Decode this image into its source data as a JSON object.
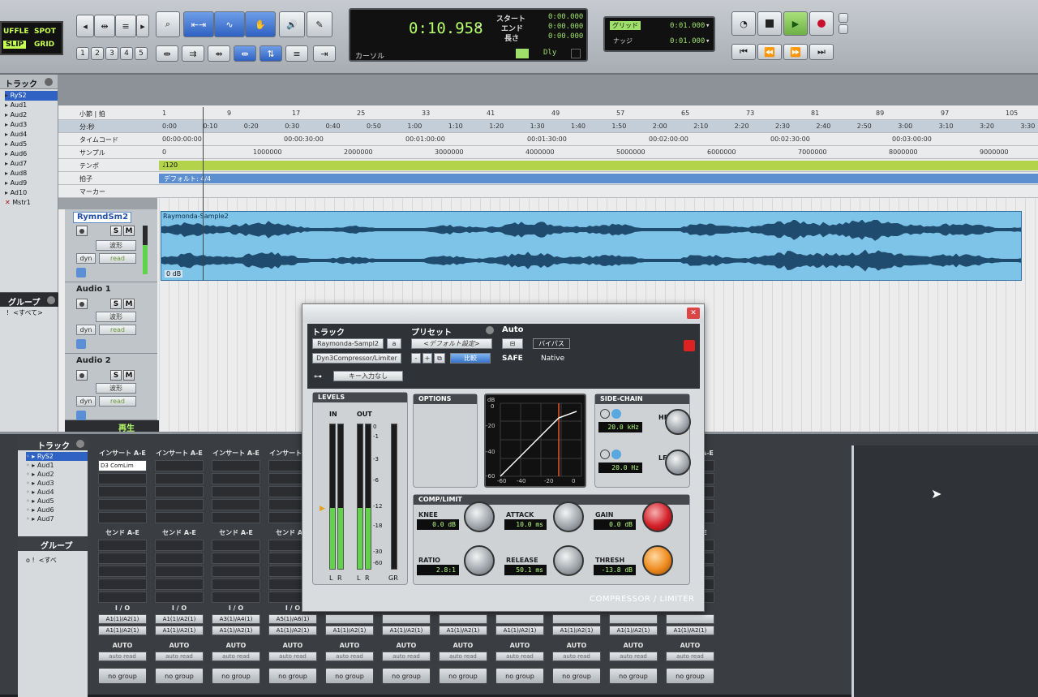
{
  "toolbar": {
    "modes": {
      "shuffle": "UFFLE",
      "spot": "SPOT",
      "slip": "SLIP",
      "grid": "GRID"
    },
    "zoom_presets": [
      "1",
      "2",
      "3",
      "4",
      "5"
    ],
    "counter": {
      "main": "0:10.958",
      "label": "カーソル",
      "start_label": "スタート",
      "end_label": "エンド",
      "length_label": "長さ",
      "start": "0:00.000",
      "end": "0:00.000",
      "length": "0:00.000",
      "dly": "Dly"
    },
    "grid": {
      "grid_label": "グリッド",
      "grid_value": "0:01.000",
      "nudge_label": "ナッジ",
      "nudge_value": "0:01.000"
    }
  },
  "sidebar": {
    "header": "トラック",
    "tracks": [
      "RyS2",
      "Aud1",
      "Aud2",
      "Aud3",
      "Aud4",
      "Aud5",
      "Aud6",
      "Aud7",
      "Aud8",
      "Aud9",
      "Ad10",
      "Mstr1"
    ],
    "groups_header": "グループ",
    "groups_all": "<すべて>"
  },
  "rulers": {
    "bars_label": "小節 | 拍",
    "mins_label": "分:秒",
    "timecode_label": "タイムコード",
    "samples_label": "サンプル",
    "tempo_label": "テンポ",
    "meter_label": "拍子",
    "marker_label": "マーカー",
    "bars": [
      "1",
      "9",
      "17",
      "25",
      "33",
      "41",
      "49",
      "57",
      "65",
      "73",
      "81",
      "89",
      "97",
      "105"
    ],
    "mins": [
      "0:00",
      "0:10",
      "0:20",
      "0:30",
      "0:40",
      "0:50",
      "1:00",
      "1:10",
      "1:20",
      "1:30",
      "1:40",
      "1:50",
      "2:00",
      "2:10",
      "2:20",
      "2:30",
      "2:40",
      "2:50",
      "3:00",
      "3:10",
      "3:20",
      "3:30"
    ],
    "timecode": [
      "00:00:00:00",
      "00:00:30:00",
      "00:01:00:00",
      "00:01:30:00",
      "00:02:00:00",
      "00:02:30:00",
      "00:03:00:00"
    ],
    "samples": [
      "0",
      "1000000",
      "2000000",
      "3000000",
      "4000000",
      "5000000",
      "6000000",
      "7000000",
      "8000000",
      "9000000"
    ],
    "tempo": "♩120",
    "meter": "デフォルト: 4/4"
  },
  "tracks": [
    {
      "name": "RymndSm2",
      "view": "波形",
      "dyn": "dyn",
      "auto": "read",
      "region": "Raymonda-Sample2",
      "gain": "0 dB"
    },
    {
      "name": "Audio 1",
      "view": "波形",
      "dyn": "dyn",
      "auto": "read"
    },
    {
      "name": "Audio 2",
      "view": "波形",
      "dyn": "dyn",
      "auto": "read"
    }
  ],
  "track_buttons": {
    "s": "S",
    "m": "M"
  },
  "edit_footer": "再生",
  "mix": {
    "header": "トラック",
    "groups_header": "グループ",
    "groups_all": "<すべ",
    "tracks": [
      "RyS2",
      "Aud1",
      "Aud2",
      "Aud3",
      "Aud4",
      "Aud5",
      "Aud6",
      "Aud7"
    ],
    "insert_label": "インサート A-E",
    "send_label": "センド A-E",
    "io_label": "I / O",
    "auto_label": "AUTO",
    "no_group": "no group",
    "first_insert": "D3 ComLim",
    "strips": [
      {
        "in": "A1(1)/A2(1)",
        "out": "A1(1)/A2(1)",
        "auto": "auto read"
      },
      {
        "in": "A1(1)/A2(1)",
        "out": "A1(1)/A2(1)",
        "auto": "auto read"
      },
      {
        "in": "A3(1)/A4(1)",
        "out": "A1(1)/A2(1)",
        "auto": "auto read"
      },
      {
        "in": "A5(1)/A6(1)",
        "out": "A1(1)/A2(1)",
        "auto": "auto read"
      },
      {
        "in": "",
        "out": "A1(1)/A2(1)",
        "auto": "auto read"
      },
      {
        "in": "",
        "out": "A1(1)/A2(1)",
        "auto": "auto read"
      },
      {
        "in": "",
        "out": "A1(1)/A2(1)",
        "auto": "auto read"
      },
      {
        "in": "",
        "out": "A1(1)/A2(1)",
        "auto": "auto read"
      },
      {
        "in": "",
        "out": "A1(1)/A2(1)",
        "auto": "auto read"
      },
      {
        "in": "",
        "out": "A1(1)/A2(1)",
        "auto": "auto read"
      },
      {
        "in": "",
        "out": "A1(1)/A2(1)",
        "auto": "auto read"
      }
    ]
  },
  "plugin": {
    "track_label": "トラック",
    "preset_label": "プリセット",
    "auto_label": "Auto",
    "track_name": "Raymonda-Sampl2",
    "track_slot": "a",
    "plugin_name": "Dyn3Compressor/Limiter",
    "preset_name": "<デフォルト設定>",
    "compare": "比較",
    "safe": "SAFE",
    "bypass": "バイパス",
    "native": "Native",
    "key_input": "キー入力なし",
    "levels_label": "LEVELS",
    "in_label": "IN",
    "out_label": "OUT",
    "gr_label": "GR",
    "l": "L",
    "r": "R",
    "scale": [
      "0",
      "-1",
      "-3",
      "-6",
      "-12",
      "-18",
      "-30",
      "-60"
    ],
    "options_label": "OPTIONS",
    "graph_y": [
      "dB",
      "0",
      "-20",
      "-40",
      "-60"
    ],
    "graph_x": [
      "-60",
      "-40",
      "-20",
      "0"
    ],
    "sidechain_label": "SIDE-CHAIN",
    "hf_label": "HF",
    "hf_value": "20.0 kHz",
    "lf_label": "LF",
    "lf_value": "20.0 Hz",
    "comp_label": "COMP/LIMIT",
    "knee_label": "KNEE",
    "knee_value": "0.0 dB",
    "attack_label": "ATTACK",
    "attack_value": "10.0 ms",
    "gain_label": "GAIN",
    "gain_value": "0.0 dB",
    "ratio_label": "RATIO",
    "ratio_value": "2.8:1",
    "release_label": "RELEASE",
    "release_value": "50.1 ms",
    "thresh_label": "THRESH",
    "thresh_value": "-13.8 dB",
    "footer": "COMPRESSOR / LIMITER"
  }
}
